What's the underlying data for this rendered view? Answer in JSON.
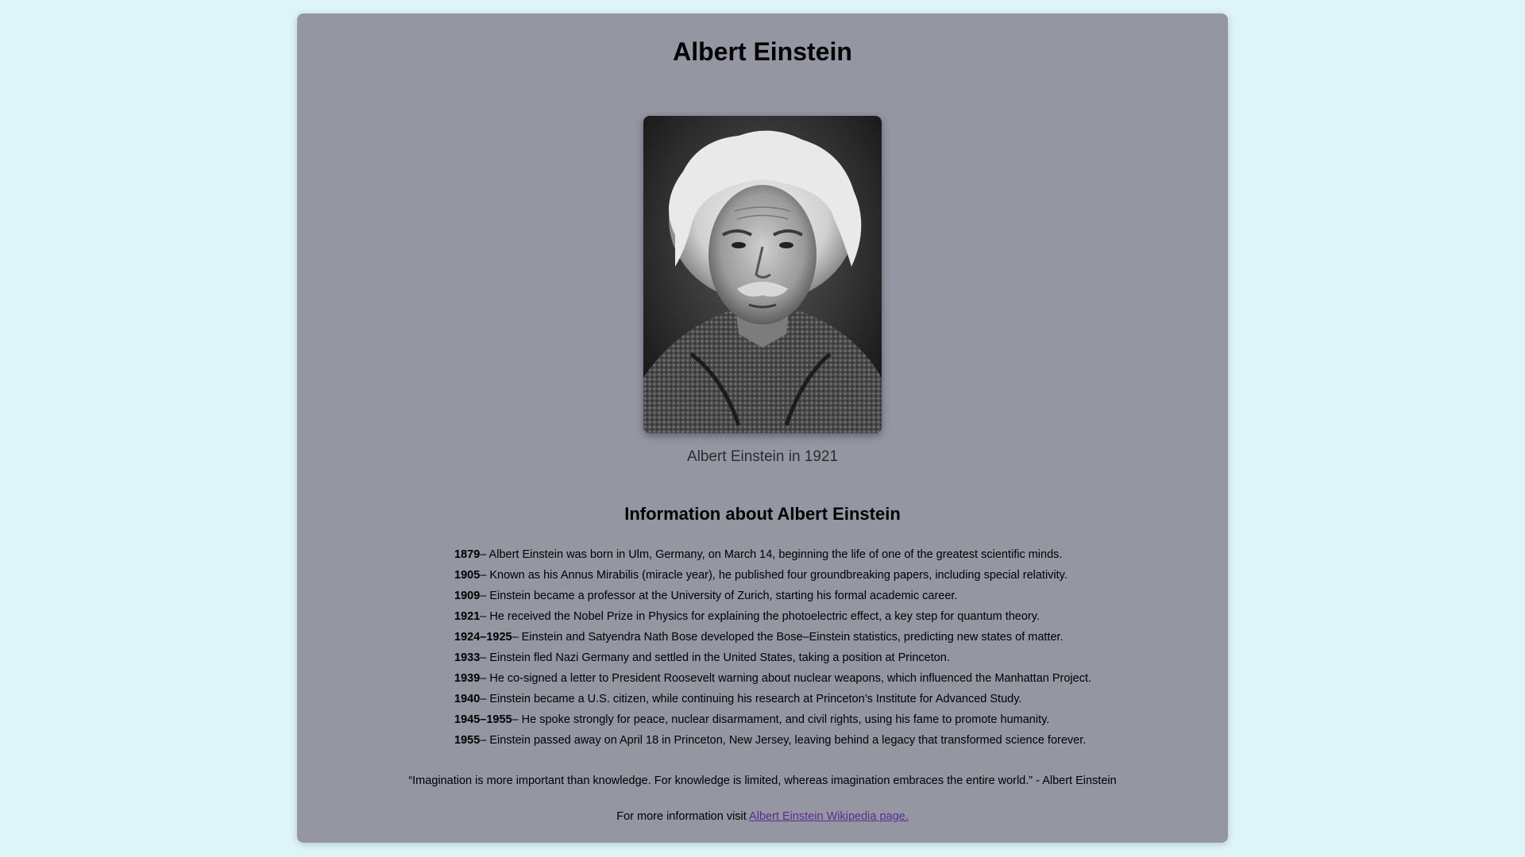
{
  "page": {
    "title": "Albert Einstein",
    "caption": "Albert Einstein in 1921",
    "section_heading": "Information about Albert Einstein"
  },
  "timeline": [
    {
      "year": "1879",
      "text": "– Albert Einstein was born in Ulm, Germany, on March 14, beginning the life of one of the greatest scientific minds."
    },
    {
      "year": "1905",
      "text": "– Known as his Annus Mirabilis (miracle year), he published four groundbreaking papers, including special relativity."
    },
    {
      "year": "1909",
      "text": "– Einstein became a professor at the University of Zurich, starting his formal academic career."
    },
    {
      "year": "1921",
      "text": "– He received the Nobel Prize in Physics for explaining the photoelectric effect, a key step for quantum theory."
    },
    {
      "year": "1924–1925",
      "text": "– Einstein and Satyendra Nath Bose developed the Bose–Einstein statistics, predicting new states of matter."
    },
    {
      "year": "1933",
      "text": "– Einstein fled Nazi Germany and settled in the United States, taking a position at Princeton."
    },
    {
      "year": "1939",
      "text": "– He co-signed a letter to President Roosevelt warning about nuclear weapons, which influenced the Manhattan Project."
    },
    {
      "year": "1940",
      "text": "– Einstein became a U.S. citizen, while continuing his research at Princeton’s Institute for Advanced Study."
    },
    {
      "year": "1945–1955",
      "text": "– He spoke strongly for peace, nuclear disarmament, and civil rights, using his fame to promote humanity."
    },
    {
      "year": "1955",
      "text": "– Einstein passed away on April 18 in Princeton, New Jersey, leaving behind a legacy that transformed science forever."
    }
  ],
  "quote": "“Imagination is more important than knowledge. For knowledge is limited, whereas imagination embraces the entire world.” - Albert Einstein",
  "footer": {
    "prefix": "For more information visit ",
    "link_text": "Albert Einstein Wikipedia page."
  },
  "colors": {
    "background": "#def5f8",
    "card": "#9496a1",
    "link": "#5b2d90"
  }
}
